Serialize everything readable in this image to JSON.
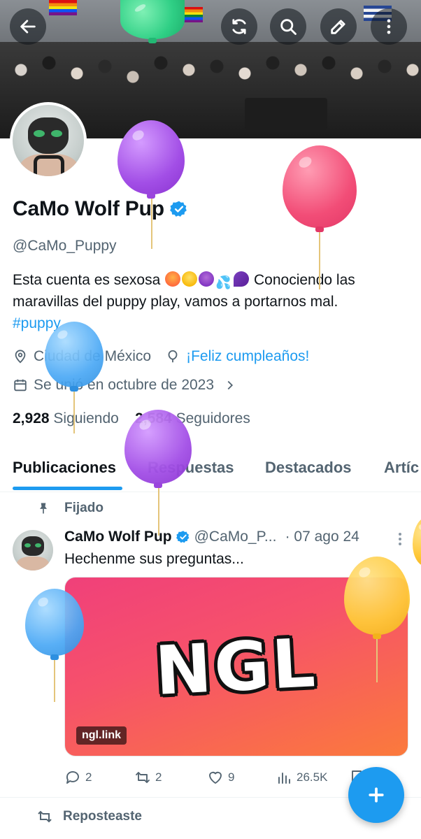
{
  "topbar": {
    "back_icon": "arrow-left-icon",
    "refresh_icon": "refresh-icon",
    "search_icon": "search-icon",
    "edit_icon": "edit-icon",
    "more_icon": "more-vertical-icon"
  },
  "profile": {
    "name": "CaMo Wolf Pup",
    "handle": "@CaMo_Puppy",
    "bio_text": "Esta cuenta es sexosa",
    "bio_text2": "Conociendo las maravillas del puppy play, vamos a portarnos mal.",
    "bio_hashtag": "#puppy",
    "location": "Ciudad de México",
    "birthday_link": "¡Feliz cumpleaños!",
    "joined": "Se unió en octubre de 2023",
    "following_count": "2,928",
    "following_label": "Siguiendo",
    "followers_count": "2,584",
    "followers_label": "Seguidores"
  },
  "tabs": [
    "Publicaciones",
    "Respuestas",
    "Destacados",
    "Artíc"
  ],
  "pinned_tweet": {
    "pinned_label": "Fijado",
    "author_name": "CaMo Wolf Pup",
    "author_handle": "@CaMo_P...",
    "date": "· 07 ago 24",
    "text": "Hechenme sus preguntas...",
    "card_title": "NGL",
    "card_domain": "ngl.link",
    "replies": "2",
    "reposts": "2",
    "likes": "9",
    "views": "26.5K"
  },
  "repost_label": "Reposteaste",
  "colors": {
    "accent": "#1d9bf0",
    "text_primary": "#0f1419",
    "text_secondary": "#536471"
  }
}
